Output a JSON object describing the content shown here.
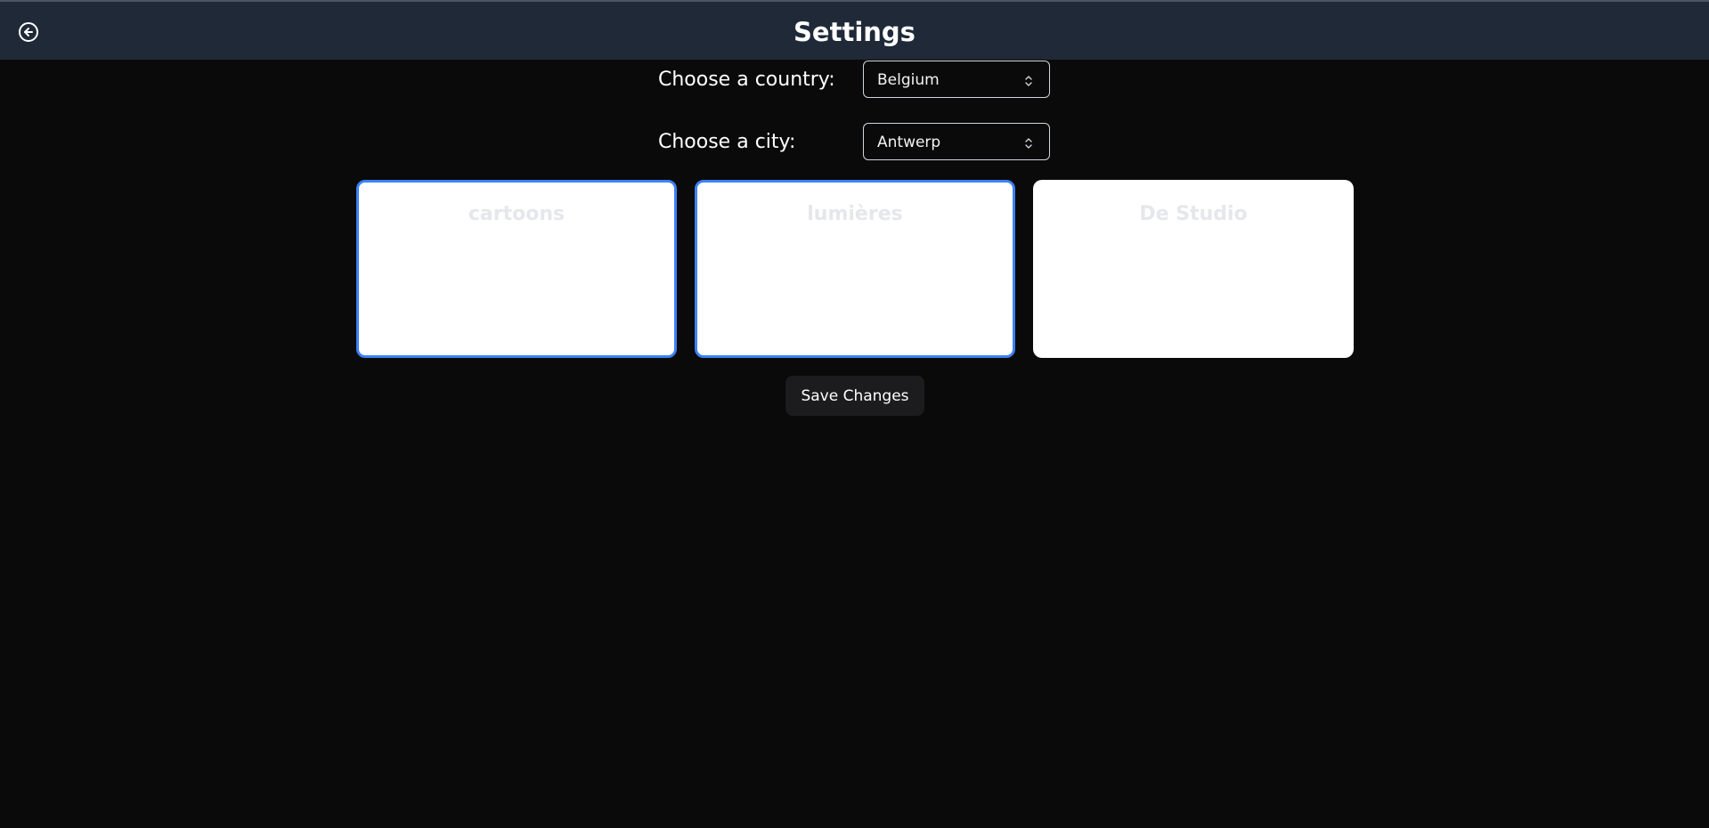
{
  "header": {
    "title": "Settings",
    "back_icon": "arrow-left-circle-icon"
  },
  "form": {
    "country": {
      "label": "Choose a country:",
      "selected": "Belgium"
    },
    "city": {
      "label": "Choose a city:",
      "selected": "Antwerp"
    },
    "select_icon": "chevron-up-down-icon"
  },
  "cinemas": [
    {
      "name": "cartoons",
      "selected": true
    },
    {
      "name": "lumières",
      "selected": true
    },
    {
      "name": "De Studio",
      "selected": false
    }
  ],
  "actions": {
    "save_label": "Save Changes"
  },
  "colors": {
    "background": "#0a0a0a",
    "header_bg": "#1f2937",
    "selected_border": "#3b82f6",
    "card_bg": "#ffffff",
    "save_bg": "#1c1c1e"
  }
}
